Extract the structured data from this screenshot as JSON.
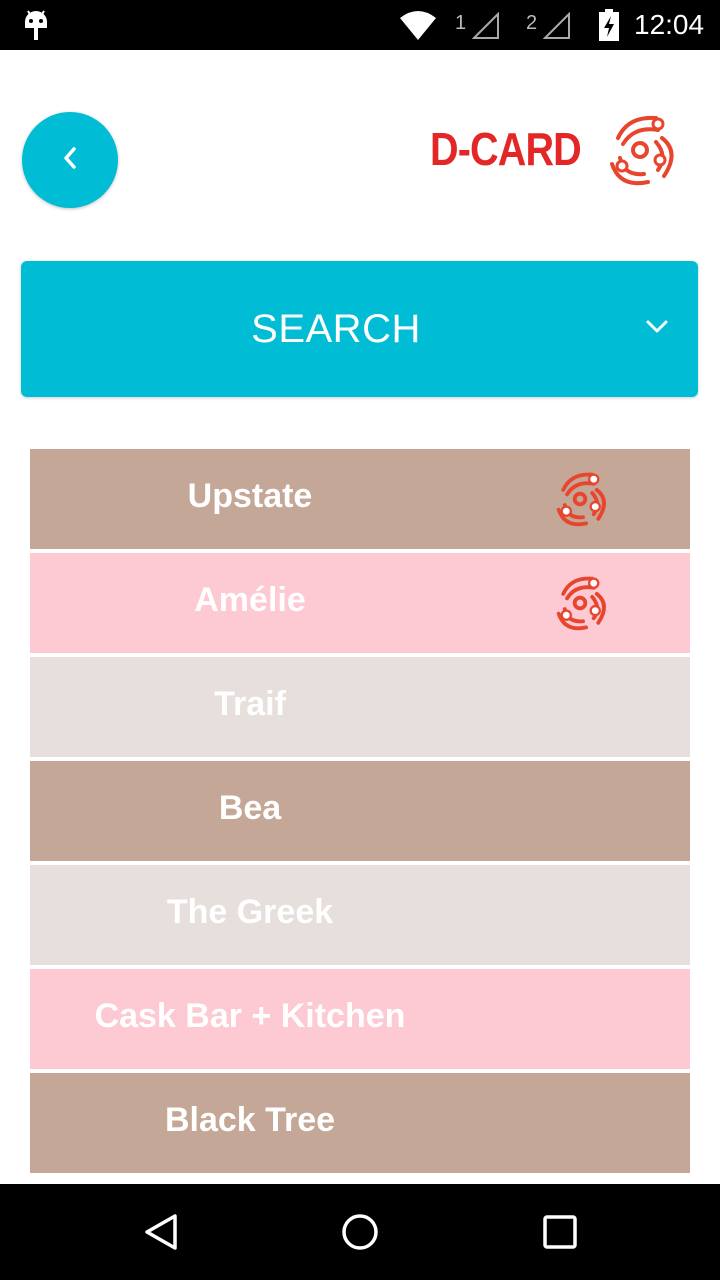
{
  "status_bar": {
    "sim1": "1",
    "sim2": "2",
    "time": "12:04"
  },
  "header": {
    "back_icon": "chevron-left-icon",
    "logo_text": "D-CARD"
  },
  "search": {
    "label": "SEARCH",
    "icon": "chevron-down-icon"
  },
  "colors": {
    "accent": "#00bcd4",
    "brand_red": "#e32626",
    "tan": "#c5a798",
    "pink": "#fdc9d2",
    "light_gray": "#e6dfdc"
  },
  "restaurants": [
    {
      "name": "Upstate",
      "color": "#c5a798",
      "has_dcard": true
    },
    {
      "name": "Amélie",
      "color": "#fdc9d2",
      "has_dcard": true
    },
    {
      "name": "Traif",
      "color": "#e6dfdc",
      "has_dcard": false
    },
    {
      "name": "Bea",
      "color": "#c5a798",
      "has_dcard": false
    },
    {
      "name": "The Greek",
      "color": "#e6dfdc",
      "has_dcard": false
    },
    {
      "name": "Cask Bar + Kitchen",
      "color": "#fdc9d2",
      "has_dcard": false
    },
    {
      "name": "Black Tree",
      "color": "#c5a798",
      "has_dcard": false
    }
  ],
  "nav_bar": {
    "back": "triangle-back-icon",
    "home": "circle-home-icon",
    "recents": "square-recents-icon"
  }
}
